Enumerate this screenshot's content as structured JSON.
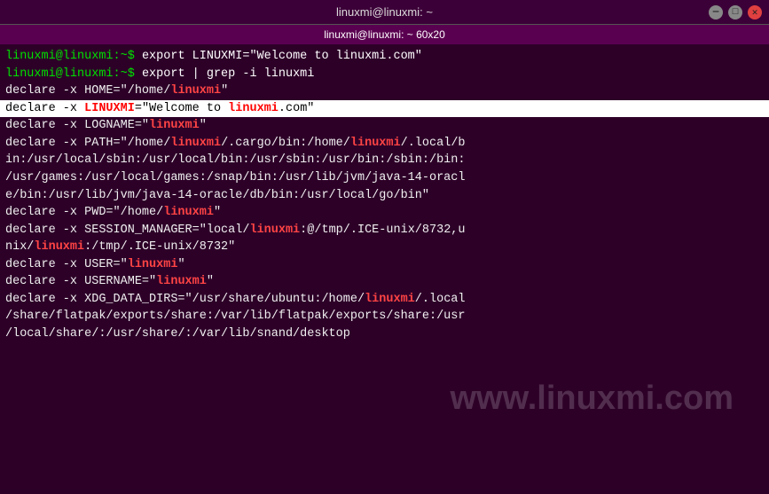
{
  "titlebar": {
    "title": "linuxmi@linuxmi: ~",
    "min_label": "—",
    "max_label": "□",
    "close_label": "✕"
  },
  "tabbar": {
    "text": "linuxmi@linuxmi: ~ 60x20"
  },
  "terminal": {
    "lines": [
      {
        "type": "prompt_cmd",
        "prompt": "linuxmi@linuxmi:~$ ",
        "cmd": "export LINUXMI=\"Welcome to linuxmi.com\""
      },
      {
        "type": "prompt_cmd",
        "prompt": "linuxmi@linuxmi:~$ ",
        "cmd": "export | grep -i linuxmi"
      },
      {
        "type": "output",
        "text": "declare -x HOME=\"/home/linuxmi\""
      },
      {
        "type": "highlighted",
        "text": "declare -x LINUXMI=\"Welcome to linuxmi.com\""
      },
      {
        "type": "output",
        "text": "declare -x LOGNAME=\"linuxmi\""
      },
      {
        "type": "output_long",
        "text": "declare -x PATH=\"/home/linuxmi/.cargo/bin:/home/linuxmi/.local/b"
      },
      {
        "type": "output_long",
        "text": "in:/usr/local/sbin:/usr/local/bin:/usr/sbin:/usr/bin:/sbin:/bin:"
      },
      {
        "type": "output_long",
        "text": "/usr/games:/usr/local/games:/snap/bin:/usr/lib/jvm/java-14-oracl"
      },
      {
        "type": "output_long",
        "text": "e/bin:/usr/lib/jvm/java-14-oracle/db/bin:/usr/local/go/bin\""
      },
      {
        "type": "output",
        "text": "declare -x PWD=\"/home/linuxmi\""
      },
      {
        "type": "output_long",
        "text": "declare -x SESSION_MANAGER=\"local/linuxmi:@/tmp/.ICE-unix/8732,u"
      },
      {
        "type": "output_long",
        "text": "nix/linuxmi:/tmp/.ICE-unix/8732\""
      },
      {
        "type": "output",
        "text": "declare -x USER=\"linuxmi\""
      },
      {
        "type": "output",
        "text": "declare -x USERNAME=\"linuxmi\""
      },
      {
        "type": "output_long",
        "text": "declare -x XDG_DATA_DIRS=\"/usr/share/ubuntu:/home/linuxmi/.local"
      },
      {
        "type": "output_long",
        "text": "/share/flatpak/exports/share:/var/lib/flatpak/exports/share:/usr"
      },
      {
        "type": "output_long",
        "text": "/local/share/:/usr/share/:/var/lib/snand/desktop"
      }
    ],
    "watermark": "www.linuxmi.com"
  }
}
